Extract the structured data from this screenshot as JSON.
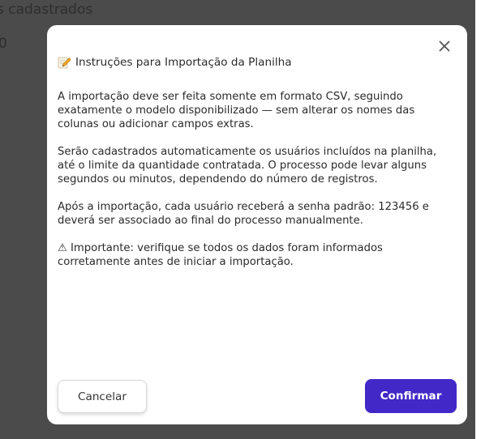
{
  "background": {
    "line1": "s cadastrados",
    "line2": "0"
  },
  "modal": {
    "close_icon": "close-icon",
    "title_icon": "memo-pencil-icon",
    "title": "Instruções para Importação da Planilha",
    "paragraphs": [
      "A importação deve ser feita somente em formato CSV, seguindo exatamente o modelo disponibilizado — sem alterar os nomes das colunas ou adicionar campos extras.",
      "Serão cadastrados automaticamente os usuários incluídos na planilha, até o limite da quantidade contratada. O processo pode levar alguns segundos ou minutos, dependendo do número de registros.",
      "Após a importação, cada usuário receberá a senha padrão: 123456 e deverá ser associado ao final do processo manualmente.",
      "⚠ Importante: verifique se todos os dados foram informados corretamente antes de iniciar a importação."
    ],
    "cancel_label": "Cancelar",
    "confirm_label": "Confirmar"
  },
  "colors": {
    "overlay": "#4b4b4b",
    "accent": "#4328c8"
  }
}
